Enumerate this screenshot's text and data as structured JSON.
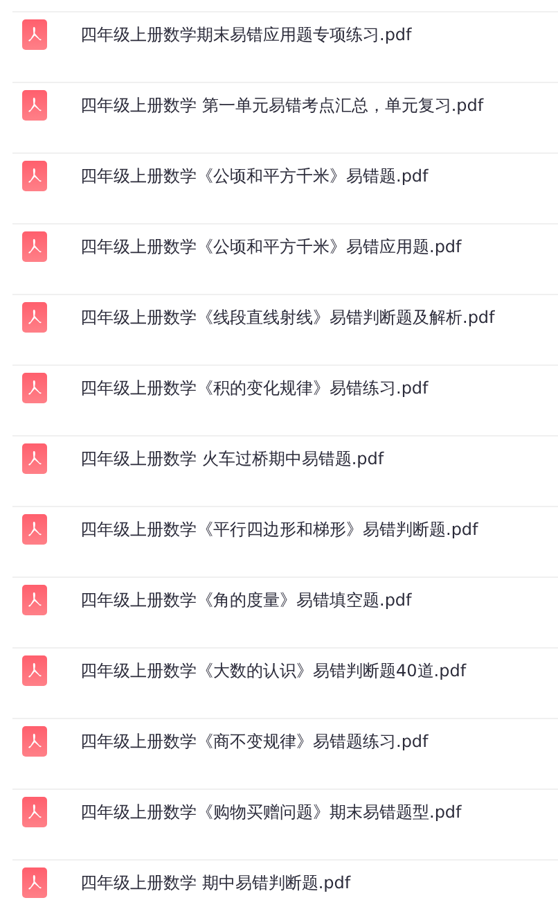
{
  "files": [
    {
      "name": "四年级上册数学期末易错应用题专项练习.pdf",
      "kind": "document"
    },
    {
      "name": "四年级上册数学 第一单元易错考点汇总，单元复习.pdf",
      "kind": "document"
    },
    {
      "name": "四年级上册数学《公顷和平方千米》易错题.pdf",
      "kind": "document"
    },
    {
      "name": "四年级上册数学《公顷和平方千米》易错应用题.pdf",
      "kind": "document"
    },
    {
      "name": "四年级上册数学《线段直线射线》易错判断题及解析.pdf",
      "kind": "document"
    },
    {
      "name": "四年级上册数学《积的变化规律》易错练习.pdf",
      "kind": "document"
    },
    {
      "name": "四年级上册数学 火车过桥期中易错题.pdf",
      "kind": "document"
    },
    {
      "name": "四年级上册数学《平行四边形和梯形》易错判断题.pdf",
      "kind": "document"
    },
    {
      "name": "四年级上册数学《角的度量》易错填空题.pdf",
      "kind": "document"
    },
    {
      "name": "四年级上册数学《大数的认识》易错判断题40道.pdf",
      "kind": "document"
    },
    {
      "name": "四年级上册数学《商不变规律》易错题练习.pdf",
      "kind": "document"
    },
    {
      "name": "四年级上册数学《购物买赠问题》期末易错题型.pdf",
      "kind": "document"
    },
    {
      "name": "四年级上册数学 期中易错判断题.pdf",
      "kind": "document"
    }
  ]
}
